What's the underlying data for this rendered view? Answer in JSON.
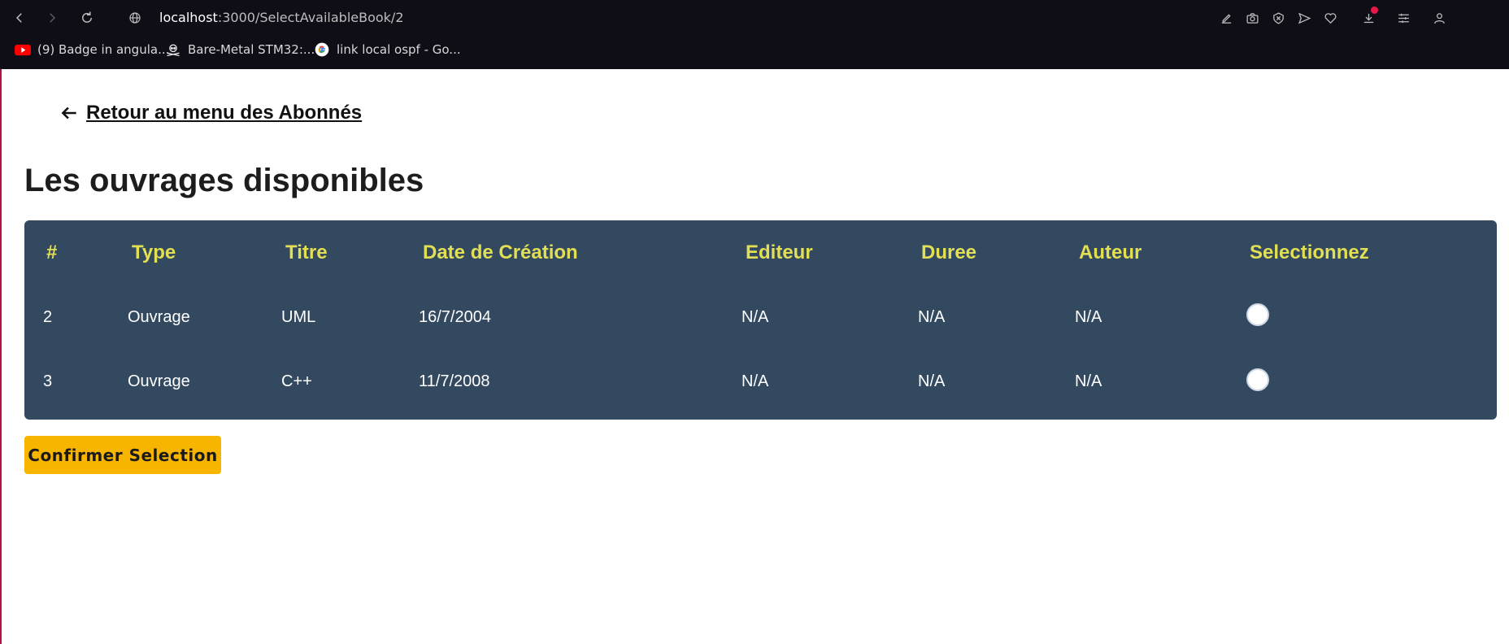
{
  "browser": {
    "url_host": "localhost",
    "url_path": ":3000/SelectAvailableBook/2",
    "bookmarks": [
      {
        "label": "(9) Badge in angula...",
        "icon": "youtube-icon"
      },
      {
        "label": "Bare-Metal STM32:...",
        "icon": "skull-crossbones-icon"
      },
      {
        "label": "link local ospf - Go...",
        "icon": "google-icon"
      }
    ]
  },
  "page": {
    "back_label": " Retour au menu des Abonnés",
    "title": "Les ouvrages disponibles",
    "confirm_label": "Confirmer Selection"
  },
  "table": {
    "headers": [
      "#",
      "Type",
      "Titre",
      "Date de Création",
      "Editeur",
      "Duree",
      "Auteur",
      "Selectionnez"
    ],
    "rows": [
      {
        "id": "2",
        "type": "Ouvrage",
        "titre": "UML",
        "date": "16/7/2004",
        "editeur": "N/A",
        "duree": "N/A",
        "auteur": "N/A"
      },
      {
        "id": "3",
        "type": "Ouvrage",
        "titre": "C++",
        "date": "11/7/2008",
        "editeur": "N/A",
        "duree": "N/A",
        "auteur": "N/A"
      }
    ]
  },
  "colors": {
    "table_bg": "#334960",
    "header_text": "#e2df54",
    "button_bg": "#f8b500",
    "chrome_bg": "#0f0e17"
  }
}
